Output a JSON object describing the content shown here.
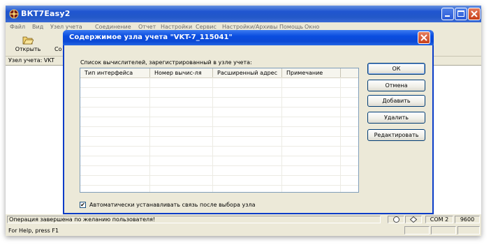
{
  "main_window": {
    "title": "ВКТ7Easy2",
    "menu": [
      "Файл",
      "Вид",
      "Узел учета",
      "Соединение",
      "Отчет",
      "Настройки",
      "Сервис",
      "Настройки/Архивы",
      "Помощь",
      "Окно"
    ],
    "toolbar": {
      "open_label": "Открыть",
      "partial_label": "Со"
    },
    "node_label": "Узел учета: VKT",
    "status": {
      "message": "Операция завершена по желанию пользователя!",
      "port": "COM 2",
      "baud": "9600"
    },
    "help_text": "For Help, press F1"
  },
  "dialog": {
    "title": "Содержимое узла учета \"VKT-7_115041\"",
    "group_label": "Список вычислителей, зарегистрированный в узле учета:",
    "columns": [
      "Тип интерфейса",
      "Номер вычис-ля",
      "Расширенный адрес",
      "Примечание"
    ],
    "buttons": {
      "ok": "ОК",
      "cancel": "Отмена",
      "add": "Добавить",
      "delete": "Удалить",
      "edit": "Редактировать"
    },
    "checkbox": {
      "label": "Автоматически устанавливать связь после выбора узла",
      "checked": true,
      "mark": "✔"
    }
  },
  "colors": {
    "titlebar": "#1f55d0",
    "dialog_titlebar": "#0a4de0",
    "face": "#ece9d8"
  }
}
